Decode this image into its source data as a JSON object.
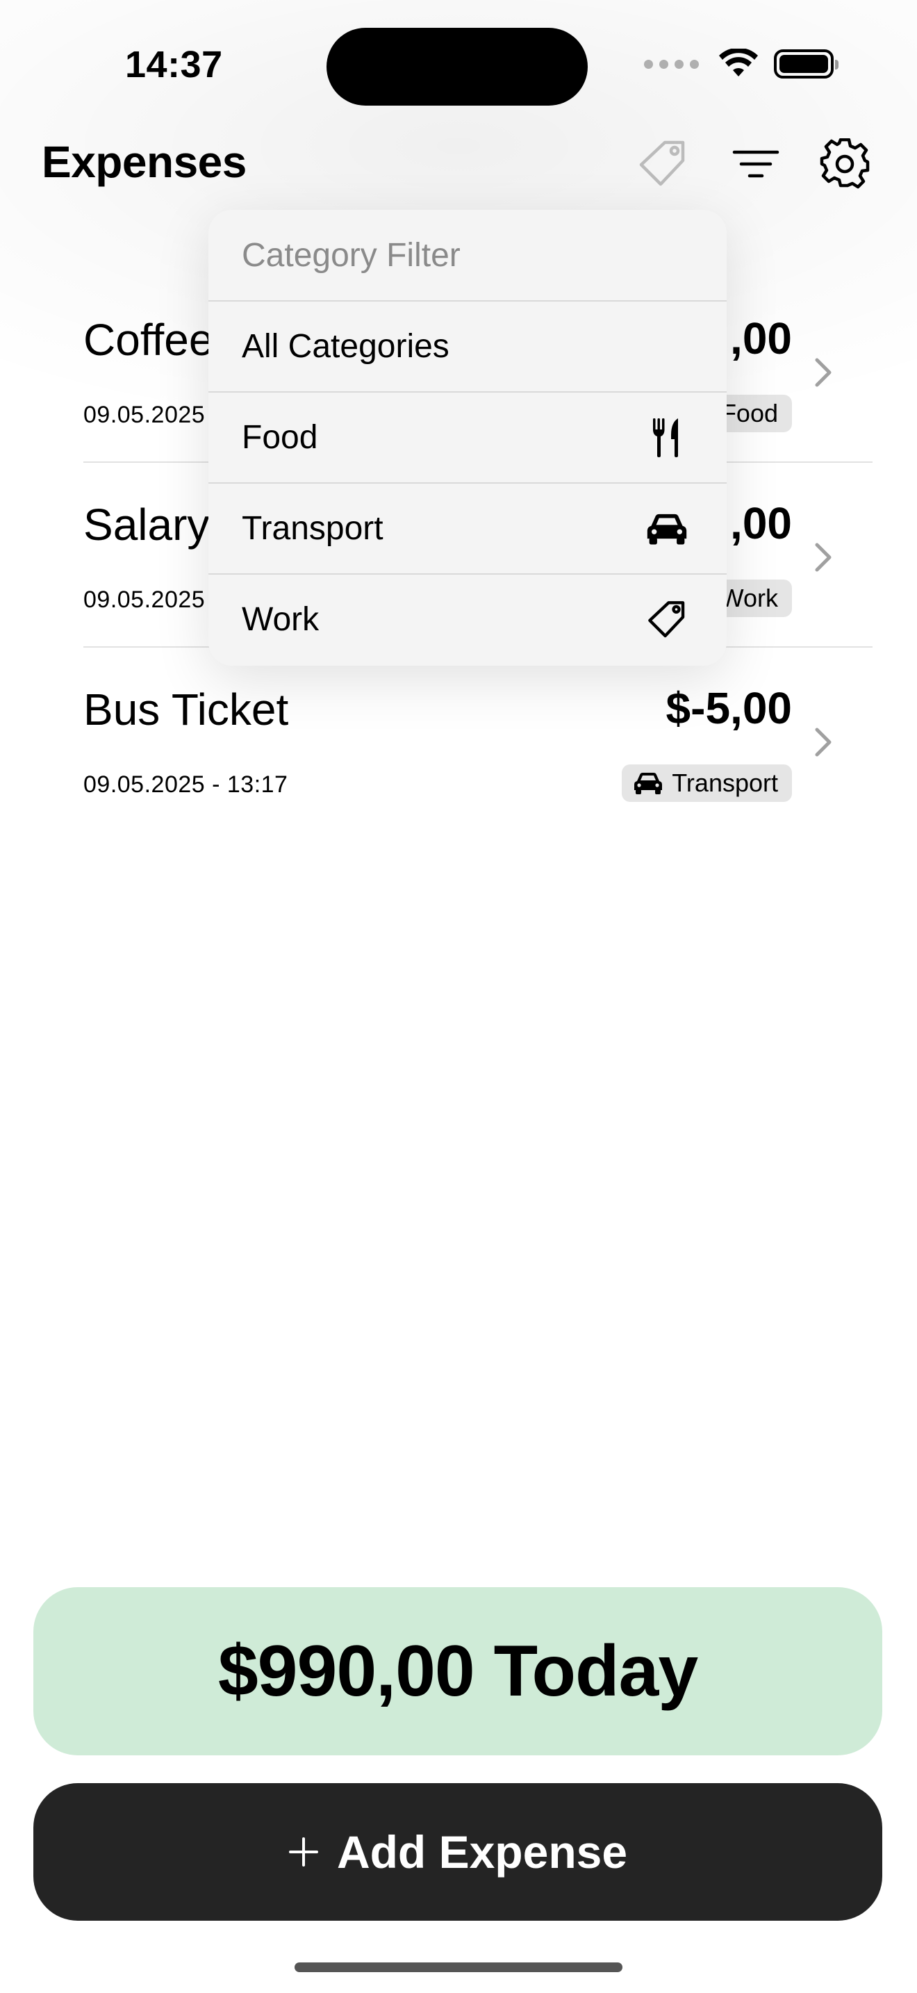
{
  "status_bar": {
    "time": "14:37"
  },
  "nav": {
    "title": "Expenses",
    "icons": [
      "tag-icon",
      "filter-icon",
      "gear-icon"
    ]
  },
  "expenses": [
    {
      "title": "Coffee",
      "date": "09.05.2025",
      "amount": ",00",
      "category": "Food"
    },
    {
      "title": "Salary",
      "date": "09.05.2025",
      "amount": ",00",
      "category": "Work"
    },
    {
      "title": "Bus Ticket",
      "date": "09.05.2025 - 13:17",
      "amount": "$-5,00",
      "category": "Transport"
    }
  ],
  "category_menu": {
    "header": "Category Filter",
    "items": [
      {
        "label": "All Categories",
        "icon": ""
      },
      {
        "label": "Food",
        "icon": "fork-knife-icon"
      },
      {
        "label": "Transport",
        "icon": "car-icon"
      },
      {
        "label": "Work",
        "icon": "tag-icon"
      }
    ]
  },
  "summary": {
    "total": "$990,00 Today"
  },
  "add_button": {
    "label": "Add Expense",
    "icon": "plus-icon"
  },
  "colors": {
    "summary_bg": "#cfebd7",
    "add_button_bg": "#242424",
    "badge_bg": "#e5e5e5",
    "menu_bg": "#f4f4f4"
  }
}
